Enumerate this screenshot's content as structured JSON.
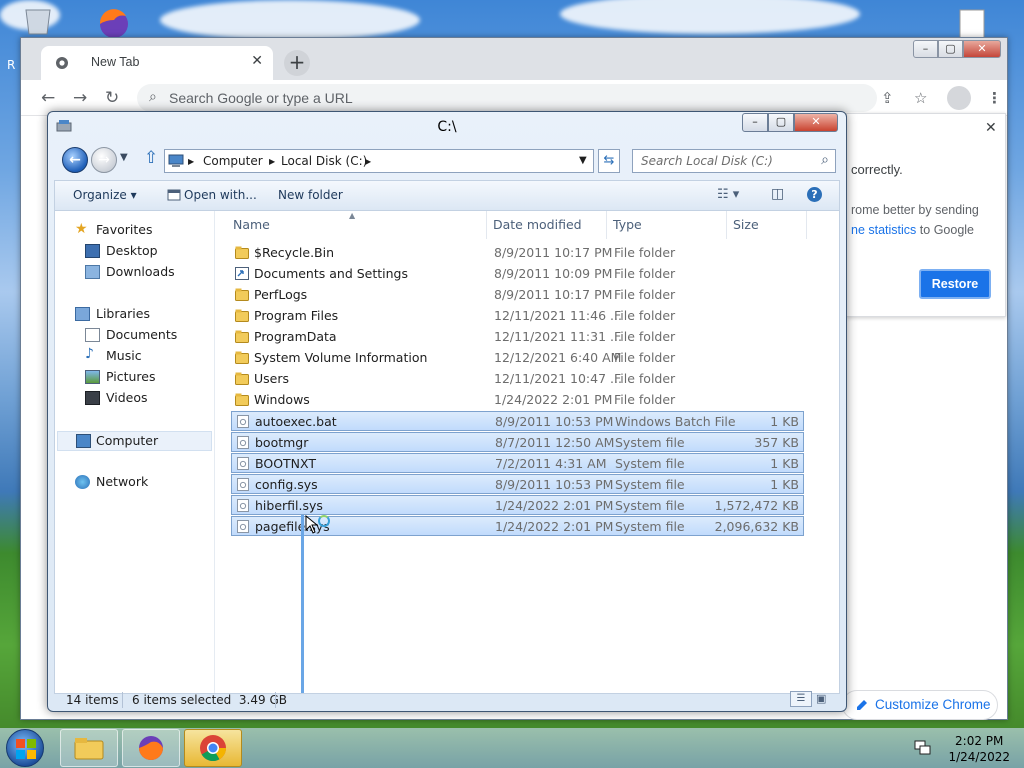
{
  "desktop": {
    "partial_label": "R"
  },
  "chrome": {
    "tab_title": "New Tab",
    "tab_close": "✕",
    "new_tab": "+",
    "omnibox_placeholder": "Search Google or type a URL",
    "window_buttons": {
      "minimize": "–",
      "maximize": "▢",
      "close": "✕"
    },
    "restore_panel": {
      "close": "✕",
      "line1": "correctly.",
      "line2": "rome better by sending",
      "line3_link": "ne statistics",
      "line3_rest": "to Google",
      "button": "Restore"
    },
    "customize_label": "Customize Chrome"
  },
  "explorer": {
    "title": "C:\\",
    "window_buttons": {
      "minimize": "–",
      "maximize": "▢",
      "close": "✕"
    },
    "breadcrumb": [
      "Computer",
      "Local Disk (C:)"
    ],
    "search_placeholder": "Search Local Disk (C:)",
    "commands": {
      "organize": "Organize ▾",
      "open_with": "Open with...",
      "new_folder": "New folder"
    },
    "nav": {
      "favorites": "Favorites",
      "desktop": "Desktop",
      "downloads": "Downloads",
      "libraries": "Libraries",
      "documents": "Documents",
      "music": "Music",
      "pictures": "Pictures",
      "videos": "Videos",
      "computer": "Computer",
      "network": "Network"
    },
    "columns": {
      "name": "Name",
      "date": "Date modified",
      "type": "Type",
      "size": "Size"
    },
    "files": [
      {
        "name": "$Recycle.Bin",
        "date": "8/9/2011 10:17 PM",
        "type": "File folder",
        "size": "",
        "kind": "folder",
        "selected": false
      },
      {
        "name": "Documents and Settings",
        "date": "8/9/2011 10:09 PM",
        "type": "File folder",
        "size": "",
        "kind": "link",
        "selected": false
      },
      {
        "name": "PerfLogs",
        "date": "8/9/2011 10:17 PM",
        "type": "File folder",
        "size": "",
        "kind": "folder",
        "selected": false
      },
      {
        "name": "Program Files",
        "date": "12/11/2021 11:46 ...",
        "type": "File folder",
        "size": "",
        "kind": "folder",
        "selected": false
      },
      {
        "name": "ProgramData",
        "date": "12/11/2021 11:31 ...",
        "type": "File folder",
        "size": "",
        "kind": "folder",
        "selected": false
      },
      {
        "name": "System Volume Information",
        "date": "12/12/2021 6:40 AM",
        "type": "File folder",
        "size": "",
        "kind": "folder",
        "selected": false
      },
      {
        "name": "Users",
        "date": "12/11/2021 10:47 ...",
        "type": "File folder",
        "size": "",
        "kind": "folder",
        "selected": false
      },
      {
        "name": "Windows",
        "date": "1/24/2022 2:01 PM",
        "type": "File folder",
        "size": "",
        "kind": "folder",
        "selected": false
      },
      {
        "name": "autoexec.bat",
        "date": "8/9/2011 10:53 PM",
        "type": "Windows Batch File",
        "size": "1 KB",
        "kind": "file",
        "selected": true
      },
      {
        "name": "bootmgr",
        "date": "8/7/2011 12:50 AM",
        "type": "System file",
        "size": "357 KB",
        "kind": "file",
        "selected": true
      },
      {
        "name": "BOOTNXT",
        "date": "7/2/2011 4:31 AM",
        "type": "System file",
        "size": "1 KB",
        "kind": "file",
        "selected": true
      },
      {
        "name": "config.sys",
        "date": "8/9/2011 10:53 PM",
        "type": "System file",
        "size": "1 KB",
        "kind": "file",
        "selected": true
      },
      {
        "name": "hiberfil.sys",
        "date": "1/24/2022 2:01 PM",
        "type": "System file",
        "size": "1,572,472 KB",
        "kind": "file",
        "selected": true
      },
      {
        "name": "pagefile.sys",
        "date": "1/24/2022 2:01 PM",
        "type": "System file",
        "size": "2,096,632 KB",
        "kind": "file",
        "selected": true
      }
    ],
    "status": {
      "count": "14 items",
      "selection": "6 items selected  3.49 GB"
    }
  },
  "taskbar": {
    "apps": [
      {
        "name": "start-button"
      },
      {
        "name": "explorer"
      },
      {
        "name": "firefox"
      },
      {
        "name": "chrome"
      }
    ],
    "time": "2:02 PM",
    "date": "1/24/2022"
  },
  "colors": {
    "selection": "#c1dbfc",
    "chrome_accent": "#1a73e8",
    "win7_frame": "#dce8f5"
  }
}
